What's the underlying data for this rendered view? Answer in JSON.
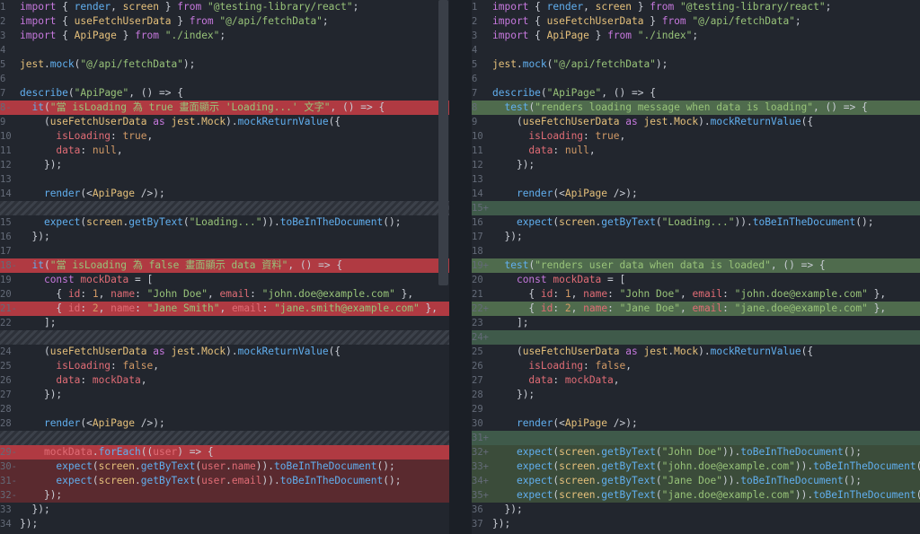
{
  "left": {
    "lines": [
      {
        "n": "1",
        "code": "import { render, screen } from \"@testing-library/react\";",
        "type": ""
      },
      {
        "n": "2",
        "code": "import { useFetchUserData } from \"@/api/fetchData\";",
        "type": ""
      },
      {
        "n": "3",
        "code": "import { ApiPage } from \"./index\";",
        "type": ""
      },
      {
        "n": "4",
        "code": "",
        "type": ""
      },
      {
        "n": "5",
        "code": "jest.mock(\"@/api/fetchData\");",
        "type": ""
      },
      {
        "n": "6",
        "code": "",
        "type": ""
      },
      {
        "n": "7",
        "code": "describe(\"ApiPage\", () => {",
        "type": ""
      },
      {
        "n": "8-",
        "code": "  it(\"當 isLoading 為 true 畫面顯示 'Loading...' 文字\", () => {",
        "type": "del-strong"
      },
      {
        "n": "9",
        "code": "    (useFetchUserData as jest.Mock).mockReturnValue({",
        "type": ""
      },
      {
        "n": "10",
        "code": "      isLoading: true,",
        "type": ""
      },
      {
        "n": "11",
        "code": "      data: null,",
        "type": ""
      },
      {
        "n": "12",
        "code": "    });",
        "type": ""
      },
      {
        "n": "13",
        "code": "",
        "type": ""
      },
      {
        "n": "14",
        "code": "    render(<ApiPage />);",
        "type": ""
      },
      {
        "n": "",
        "code": "",
        "type": "hatch"
      },
      {
        "n": "15",
        "code": "    expect(screen.getByText(\"Loading...\")).toBeInTheDocument();",
        "type": ""
      },
      {
        "n": "16",
        "code": "  });",
        "type": ""
      },
      {
        "n": "17",
        "code": "",
        "type": ""
      },
      {
        "n": "18-",
        "code": "  it(\"當 isLoading 為 false 畫面顯示 data 資料\", () => {",
        "type": "del-strong"
      },
      {
        "n": "19",
        "code": "    const mockData = [",
        "type": ""
      },
      {
        "n": "20",
        "code": "      { id: 1, name: \"John Doe\", email: \"john.doe@example.com\" },",
        "type": ""
      },
      {
        "n": "21-",
        "code": "      { id: 2, name: \"Jane Smith\", email: \"jane.smith@example.com\" },",
        "type": "del-strong"
      },
      {
        "n": "22",
        "code": "    ];",
        "type": ""
      },
      {
        "n": "",
        "code": "",
        "type": "hatch"
      },
      {
        "n": "24",
        "code": "    (useFetchUserData as jest.Mock).mockReturnValue({",
        "type": ""
      },
      {
        "n": "25",
        "code": "      isLoading: false,",
        "type": ""
      },
      {
        "n": "26",
        "code": "      data: mockData,",
        "type": ""
      },
      {
        "n": "27",
        "code": "    });",
        "type": ""
      },
      {
        "n": "28",
        "code": "",
        "type": ""
      },
      {
        "n": "28",
        "code": "    render(<ApiPage />);",
        "type": ""
      },
      {
        "n": "",
        "code": "",
        "type": "hatch"
      },
      {
        "n": "29-",
        "code": "    mockData.forEach((user) => {",
        "type": "del-strong"
      },
      {
        "n": "30-",
        "code": "      expect(screen.getByText(user.name)).toBeInTheDocument();",
        "type": "del"
      },
      {
        "n": "31-",
        "code": "      expect(screen.getByText(user.email)).toBeInTheDocument();",
        "type": "del"
      },
      {
        "n": "32-",
        "code": "    });",
        "type": "del"
      },
      {
        "n": "33",
        "code": "  });",
        "type": ""
      },
      {
        "n": "34",
        "code": "});",
        "type": ""
      }
    ]
  },
  "right": {
    "lines": [
      {
        "n": "1",
        "code": "import { render, screen } from \"@testing-library/react\";",
        "type": ""
      },
      {
        "n": "2",
        "code": "import { useFetchUserData } from \"@/api/fetchData\";",
        "type": ""
      },
      {
        "n": "3",
        "code": "import { ApiPage } from \"./index\";",
        "type": ""
      },
      {
        "n": "4",
        "code": "",
        "type": ""
      },
      {
        "n": "5",
        "code": "jest.mock(\"@/api/fetchData\");",
        "type": ""
      },
      {
        "n": "6",
        "code": "",
        "type": ""
      },
      {
        "n": "7",
        "code": "describe(\"ApiPage\", () => {",
        "type": ""
      },
      {
        "n": "8",
        "code": "  test(\"renders loading message when data is loading\", () => {",
        "type": "add-strong"
      },
      {
        "n": "9",
        "code": "    (useFetchUserData as jest.Mock).mockReturnValue({",
        "type": ""
      },
      {
        "n": "10",
        "code": "      isLoading: true,",
        "type": ""
      },
      {
        "n": "11",
        "code": "      data: null,",
        "type": ""
      },
      {
        "n": "12",
        "code": "    });",
        "type": ""
      },
      {
        "n": "13",
        "code": "",
        "type": ""
      },
      {
        "n": "14",
        "code": "    render(<ApiPage />);",
        "type": ""
      },
      {
        "n": "15+",
        "code": "",
        "type": "addfill"
      },
      {
        "n": "16",
        "code": "    expect(screen.getByText(\"Loading...\")).toBeInTheDocument();",
        "type": ""
      },
      {
        "n": "17",
        "code": "  });",
        "type": ""
      },
      {
        "n": "18",
        "code": "",
        "type": ""
      },
      {
        "n": "19+",
        "code": "  test(\"renders user data when data is loaded\", () => {",
        "type": "add-strong"
      },
      {
        "n": "20",
        "code": "    const mockData = [",
        "type": ""
      },
      {
        "n": "21",
        "code": "      { id: 1, name: \"John Doe\", email: \"john.doe@example.com\" },",
        "type": ""
      },
      {
        "n": "22+",
        "code": "      { id: 2, name: \"Jane Doe\", email: \"jane.doe@example.com\" },",
        "type": "add-strong"
      },
      {
        "n": "23",
        "code": "    ];",
        "type": ""
      },
      {
        "n": "24+",
        "code": "",
        "type": "addfill"
      },
      {
        "n": "25",
        "code": "    (useFetchUserData as jest.Mock).mockReturnValue({",
        "type": ""
      },
      {
        "n": "26",
        "code": "      isLoading: false,",
        "type": ""
      },
      {
        "n": "27",
        "code": "      data: mockData,",
        "type": ""
      },
      {
        "n": "28",
        "code": "    });",
        "type": ""
      },
      {
        "n": "29",
        "code": "",
        "type": ""
      },
      {
        "n": "30",
        "code": "    render(<ApiPage />);",
        "type": ""
      },
      {
        "n": "31+",
        "code": "",
        "type": "addfill"
      },
      {
        "n": "32+",
        "code": "    expect(screen.getByText(\"John Doe\")).toBeInTheDocument();",
        "type": "add"
      },
      {
        "n": "33+",
        "code": "    expect(screen.getByText(\"john.doe@example.com\")).toBeInTheDocument();",
        "type": "add"
      },
      {
        "n": "34+",
        "code": "    expect(screen.getByText(\"Jane Doe\")).toBeInTheDocument();",
        "type": "add"
      },
      {
        "n": "35+",
        "code": "    expect(screen.getByText(\"jane.doe@example.com\")).toBeInTheDocument();",
        "type": "add"
      },
      {
        "n": "36",
        "code": "  });",
        "type": ""
      },
      {
        "n": "37",
        "code": "});",
        "type": ""
      }
    ]
  },
  "colors": {
    "background": "#22262e",
    "deletion": "#b03a42",
    "addition": "#4f6b4d",
    "keyword": "#c678dd",
    "function": "#61afef",
    "string": "#98c379",
    "number": "#d19a66"
  }
}
